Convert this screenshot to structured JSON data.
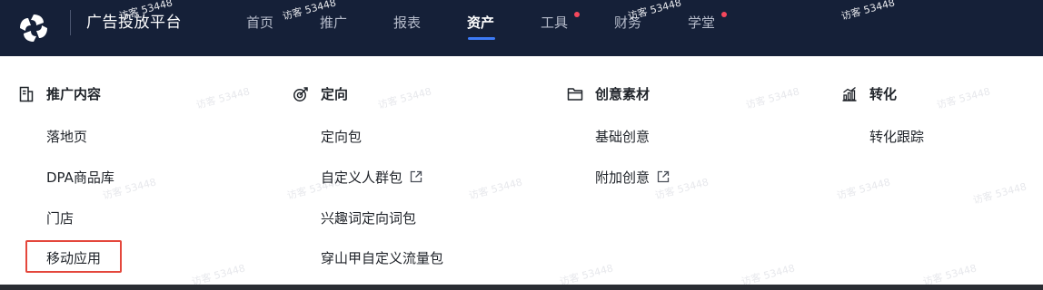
{
  "brand": {
    "name": "广告投放平台",
    "accent_color": "#3d7bf7",
    "nav_bg": "#152038",
    "logo_icon": "pinwheel-logo-icon"
  },
  "nav": {
    "items": [
      {
        "label": "首页",
        "active": false,
        "dot": false
      },
      {
        "label": "推广",
        "active": false,
        "dot": false
      },
      {
        "label": "报表",
        "active": false,
        "dot": false
      },
      {
        "label": "资产",
        "active": true,
        "dot": false
      },
      {
        "label": "工具",
        "active": false,
        "dot": true
      },
      {
        "label": "财务",
        "active": false,
        "dot": false
      },
      {
        "label": "学堂",
        "active": false,
        "dot": true
      }
    ],
    "dot_color": "#f5475c"
  },
  "menu": {
    "columns": [
      {
        "title": "推广内容",
        "icon": "document-icon",
        "items": [
          {
            "label": "落地页",
            "external": false
          },
          {
            "label": "DPA商品库",
            "external": false
          },
          {
            "label": "门店",
            "external": false
          },
          {
            "label": "移动应用",
            "external": false,
            "highlighted": true
          }
        ]
      },
      {
        "title": "定向",
        "icon": "target-icon",
        "items": [
          {
            "label": "定向包",
            "external": false
          },
          {
            "label": "自定义人群包",
            "external": true
          },
          {
            "label": "兴趣词定向词包",
            "external": false
          },
          {
            "label": "穿山甲自定义流量包",
            "external": false
          }
        ]
      },
      {
        "title": "创意素材",
        "icon": "folder-icon",
        "items": [
          {
            "label": "基础创意",
            "external": false
          },
          {
            "label": "附加创意",
            "external": true
          }
        ]
      },
      {
        "title": "转化",
        "icon": "bar-chart-icon",
        "items": [
          {
            "label": "转化跟踪",
            "external": false
          }
        ]
      }
    ],
    "highlight_color": "#e4473c"
  },
  "watermark": {
    "text": "访客 53448"
  }
}
